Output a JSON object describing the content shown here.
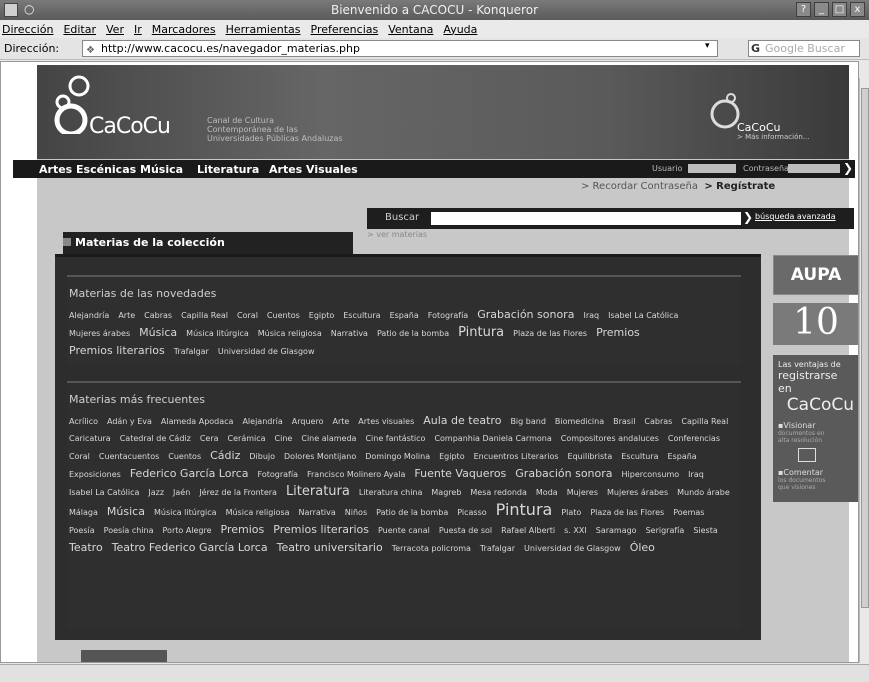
{
  "window": {
    "title": "Bienvenido a CACOCU - Konqueror",
    "controls": [
      "?",
      "_",
      "□",
      "x"
    ]
  },
  "menubar": {
    "items": [
      "Dirección",
      "Editar",
      "Ver",
      "Ir",
      "Marcadores",
      "Herramientas",
      "Preferencias",
      "Ventana",
      "Ayuda"
    ]
  },
  "addressbar": {
    "label": "Dirección:",
    "url": "http://www.cacocu.es/navegador_materias.php",
    "search_placeholder": "Google Buscar"
  },
  "header": {
    "logo_text": "CaCoCu",
    "tagline": [
      "Canal de Cultura",
      "Contemporánea de las",
      "Universidades Públicas Andaluzas"
    ],
    "right_logo_text": "CaCoCu",
    "right_logo_sub": "> Más información..."
  },
  "nav": {
    "items": [
      "Artes Escénicas",
      "Música",
      "Literatura",
      "Artes Visuales"
    ],
    "usuario_label": "Usuario",
    "contrasena_label": "Contraseña",
    "recordar": "> Recordar Contraseña",
    "registrate": "> Regístrate"
  },
  "search": {
    "label": "Buscar",
    "advanced": "búsqueda avanzada",
    "ver_materias": "> ver materias"
  },
  "panel": {
    "title": "Materias de la colección",
    "novedades": {
      "title": "Materias de las novedades",
      "tags": [
        {
          "t": "Alejandría",
          "s": 1
        },
        {
          "t": "Arte",
          "s": 1
        },
        {
          "t": "Cabras",
          "s": 1
        },
        {
          "t": "Capilla Real",
          "s": 1
        },
        {
          "t": "Coral",
          "s": 1
        },
        {
          "t": "Cuentos",
          "s": 1
        },
        {
          "t": "Egipto",
          "s": 1
        },
        {
          "t": "Escultura",
          "s": 1
        },
        {
          "t": "España",
          "s": 1
        },
        {
          "t": "Fotografía",
          "s": 1
        },
        {
          "t": "Grabación sonora",
          "s": 2
        },
        {
          "t": "Iraq",
          "s": 1
        },
        {
          "t": "Isabel La Católica",
          "s": 1
        },
        {
          "t": "Mujeres árabes",
          "s": 1
        },
        {
          "t": "Música",
          "s": 2
        },
        {
          "t": "Música litúrgica",
          "s": 1
        },
        {
          "t": "Música religiosa",
          "s": 1
        },
        {
          "t": "Narrativa",
          "s": 1
        },
        {
          "t": "Patio de la bomba",
          "s": 1
        },
        {
          "t": "Pintura",
          "s": 3
        },
        {
          "t": "Plaza de las Flores",
          "s": 1
        },
        {
          "t": "Premios",
          "s": 2
        },
        {
          "t": "Premios literarios",
          "s": 2
        },
        {
          "t": "Trafalgar",
          "s": 1
        },
        {
          "t": "Universidad de Glasgow",
          "s": 1
        }
      ]
    },
    "frecuentes": {
      "title": "Materias más frecuentes",
      "tags": [
        {
          "t": "Acrílico",
          "s": 1
        },
        {
          "t": "Adán y Eva",
          "s": 1
        },
        {
          "t": "Alameda Apodaca",
          "s": 1
        },
        {
          "t": "Alejandría",
          "s": 1
        },
        {
          "t": "Arquero",
          "s": 1
        },
        {
          "t": "Arte",
          "s": 1
        },
        {
          "t": "Artes visuales",
          "s": 1
        },
        {
          "t": "Aula de teatro",
          "s": 2
        },
        {
          "t": "Big band",
          "s": 1
        },
        {
          "t": "Biomedicina",
          "s": 1
        },
        {
          "t": "Brasil",
          "s": 1
        },
        {
          "t": "Cabras",
          "s": 1
        },
        {
          "t": "Capilla Real",
          "s": 1
        },
        {
          "t": "Caricatura",
          "s": 1
        },
        {
          "t": "Catedral de Cádiz",
          "s": 1
        },
        {
          "t": "Cera",
          "s": 1
        },
        {
          "t": "Cerámica",
          "s": 1
        },
        {
          "t": "Cine",
          "s": 1
        },
        {
          "t": "Cine alameda",
          "s": 1
        },
        {
          "t": "Cine fantástico",
          "s": 1
        },
        {
          "t": "Companhia Daniela Carmona",
          "s": 1
        },
        {
          "t": "Compositores andaluces",
          "s": 1
        },
        {
          "t": "Conferencias",
          "s": 1
        },
        {
          "t": "Coral",
          "s": 1
        },
        {
          "t": "Cuentacuentos",
          "s": 1
        },
        {
          "t": "Cuentos",
          "s": 1
        },
        {
          "t": "Cádiz",
          "s": 2
        },
        {
          "t": "Dibujo",
          "s": 1
        },
        {
          "t": "Dolores Montijano",
          "s": 1
        },
        {
          "t": "Domingo Molina",
          "s": 1
        },
        {
          "t": "Egipto",
          "s": 1
        },
        {
          "t": "Encuentros Literarios",
          "s": 1
        },
        {
          "t": "Equilibrista",
          "s": 1
        },
        {
          "t": "Escultura",
          "s": 1
        },
        {
          "t": "España",
          "s": 1
        },
        {
          "t": "Exposiciones",
          "s": 1
        },
        {
          "t": "Federico García Lorca",
          "s": 2
        },
        {
          "t": "Fotografía",
          "s": 1
        },
        {
          "t": "Francisco Molinero Ayala",
          "s": 1
        },
        {
          "t": "Fuente Vaqueros",
          "s": 2
        },
        {
          "t": "Grabación sonora",
          "s": 2
        },
        {
          "t": "Hiperconsumo",
          "s": 1
        },
        {
          "t": "Iraq",
          "s": 1
        },
        {
          "t": "Isabel La Católica",
          "s": 1
        },
        {
          "t": "Jazz",
          "s": 1
        },
        {
          "t": "Jaén",
          "s": 1
        },
        {
          "t": "Jérez de la Frontera",
          "s": 1
        },
        {
          "t": "Literatura",
          "s": 3
        },
        {
          "t": "Literatura china",
          "s": 1
        },
        {
          "t": "Magreb",
          "s": 1
        },
        {
          "t": "Mesa redonda",
          "s": 1
        },
        {
          "t": "Moda",
          "s": 1
        },
        {
          "t": "Mujeres",
          "s": 1
        },
        {
          "t": "Mujeres árabes",
          "s": 1
        },
        {
          "t": "Mundo árabe",
          "s": 1
        },
        {
          "t": "Málaga",
          "s": 1
        },
        {
          "t": "Música",
          "s": 2
        },
        {
          "t": "Música litúrgica",
          "s": 1
        },
        {
          "t": "Música religiosa",
          "s": 1
        },
        {
          "t": "Narrativa",
          "s": 1
        },
        {
          "t": "Niños",
          "s": 1
        },
        {
          "t": "Patio de la bomba",
          "s": 1
        },
        {
          "t": "Picasso",
          "s": 1
        },
        {
          "t": "Pintura",
          "s": 4
        },
        {
          "t": "Plato",
          "s": 1
        },
        {
          "t": "Plaza de las Flores",
          "s": 1
        },
        {
          "t": "Poemas",
          "s": 1
        },
        {
          "t": "Poesía",
          "s": 1
        },
        {
          "t": "Poesía china",
          "s": 1
        },
        {
          "t": "Porto Alegre",
          "s": 1
        },
        {
          "t": "Premios",
          "s": 2
        },
        {
          "t": "Premios literarios",
          "s": 2
        },
        {
          "t": "Puente canal",
          "s": 1
        },
        {
          "t": "Puesta de sol",
          "s": 1
        },
        {
          "t": "Rafael Alberti",
          "s": 1
        },
        {
          "t": "s. XXI",
          "s": 1
        },
        {
          "t": "Saramago",
          "s": 1
        },
        {
          "t": "Serigrafía",
          "s": 1
        },
        {
          "t": "Siesta",
          "s": 1
        },
        {
          "t": "Teatro",
          "s": 2
        },
        {
          "t": "Teatro Federico García Lorca",
          "s": 2
        },
        {
          "t": "Teatro universitario",
          "s": 2
        },
        {
          "t": "Terracota policroma",
          "s": 1
        },
        {
          "t": "Trafalgar",
          "s": 1
        },
        {
          "t": "Universidad de Glasgow",
          "s": 1
        },
        {
          "t": "Óleo",
          "s": 2
        }
      ]
    }
  },
  "sidebar": {
    "aupa": "AUPA",
    "ten": "10",
    "ventajas": {
      "line1": "Las ventajas de",
      "line2": "registrarse",
      "line2b": "en",
      "brand": "CaCoCu",
      "p1": "Visionar",
      "p1sub": "documentos en",
      "p1sub2": "alta resolución",
      "p2": "Comentar",
      "p2sub": "los documentos",
      "p2sub2": "que visiones"
    }
  }
}
